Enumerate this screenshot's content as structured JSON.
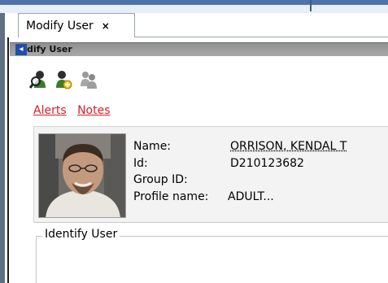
{
  "tab": {
    "title": "Modify User",
    "close_label": "×"
  },
  "panel": {
    "collapse_label": "◂",
    "title": "dify User"
  },
  "toolbar": {
    "icons": [
      "search-user-icon",
      "add-user-icon",
      "user-group-icon"
    ]
  },
  "links": {
    "alerts": "Alerts",
    "notes": "Notes"
  },
  "profile": {
    "name_label": "Name:",
    "name_value": "ORRISON, KENDAL T",
    "id_label": "Id:",
    "id_value": "D210123682",
    "group_label": "Group ID:",
    "group_value": "",
    "profile_label": "Profile name:",
    "profile_value": "ADULT..."
  },
  "section": {
    "legend": "Identify User"
  },
  "colors": {
    "link": "#d42121",
    "header_bar": "#9a9a9a",
    "accent_blue": "#4f73a8"
  }
}
